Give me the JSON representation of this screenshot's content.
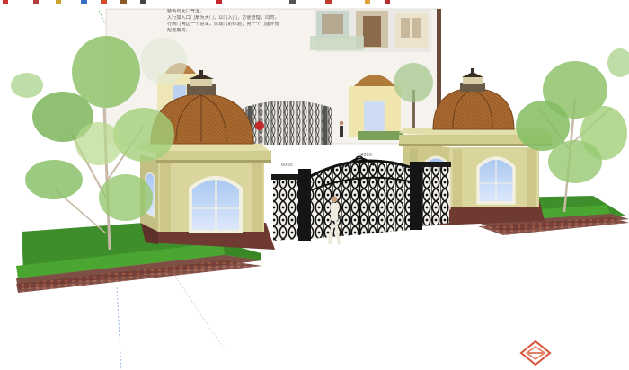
{
  "toolbar": {
    "tools": [
      "select-tool",
      "eraser-tool",
      "paint-tool",
      "move-tool",
      "rotate-tool",
      "push-pull-tool",
      "offset-tool",
      "tape-tool",
      "text-tool",
      "orbit-tool",
      "pan-tool",
      "zoom-tool"
    ]
  },
  "backdrop": {
    "text_lines": [
      "特色与大门气派。",
      "入行加入口门扇为大门，以门入门，方便管理，同时，",
      "行间门两边一个进车，体现门的体验，另一个门能外管",
      "配置用的。"
    ]
  },
  "dimensions": {
    "left": "6000",
    "right": "14000"
  },
  "colors": {
    "grass": "#3f8f2c",
    "hedge": "#4aa631",
    "wall": "#d8d49a",
    "dome": "#a9692f",
    "iron": "#151515",
    "brick": "#8a4b3e",
    "accent": "#c3262b"
  },
  "watermark": {
    "icon": "diamond-logo-icon"
  }
}
